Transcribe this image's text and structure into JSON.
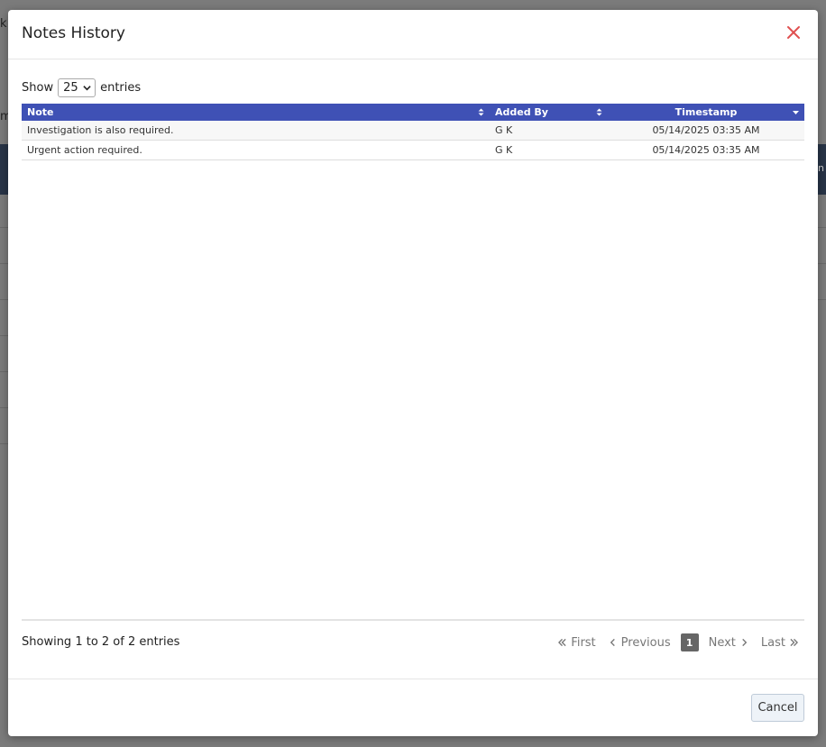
{
  "modal": {
    "title": "Notes History",
    "cancel_label": "Cancel"
  },
  "length_menu": {
    "show_label": "Show",
    "selected": "25",
    "entries_label": "entries"
  },
  "table": {
    "columns": [
      "Note",
      "Added By",
      "Timestamp"
    ],
    "rows": [
      {
        "note": "Investigation is also required.",
        "added_by": "G K",
        "timestamp": "05/14/2025 03:35 AM"
      },
      {
        "note": "Urgent action required.",
        "added_by": "G K",
        "timestamp": "05/14/2025 03:35 AM"
      }
    ]
  },
  "info_text": "Showing 1 to 2 of 2 entries",
  "pagination": {
    "first": "First",
    "previous": "Previous",
    "current_page": "1",
    "next": "Next",
    "last": "Last"
  },
  "background": {
    "frag_top": "k",
    "frag_mid": "m",
    "frag_right": "n"
  },
  "colors": {
    "header_bg": "#3f51b5",
    "close_icon": "#e05050"
  }
}
